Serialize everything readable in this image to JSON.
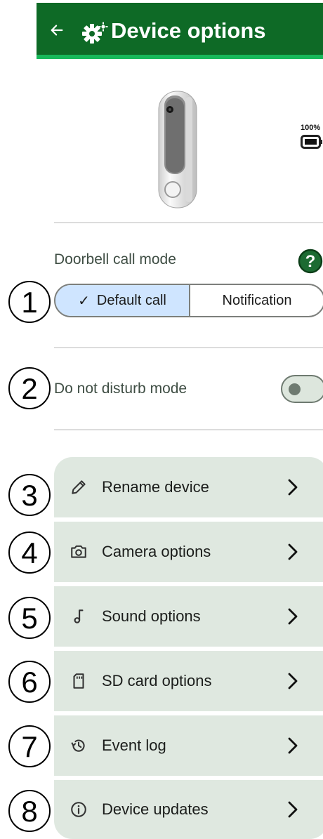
{
  "header": {
    "title": "Device options"
  },
  "device": {
    "battery_text": "100%"
  },
  "call_mode": {
    "title": "Doorbell call mode",
    "options": [
      "Default call",
      "Notification"
    ],
    "selected": "Default call"
  },
  "dnd": {
    "title": "Do not disturb mode",
    "enabled": false
  },
  "menu": {
    "items": [
      {
        "label": "Rename device",
        "icon": "pencil-icon"
      },
      {
        "label": "Camera options",
        "icon": "camera-icon"
      },
      {
        "label": "Sound options",
        "icon": "music-note-icon"
      },
      {
        "label": "SD card options",
        "icon": "sd-card-icon"
      },
      {
        "label": "Event log",
        "icon": "history-icon"
      },
      {
        "label": "Device updates",
        "icon": "info-icon"
      }
    ]
  },
  "annotations": [
    "1",
    "2",
    "3",
    "4",
    "5",
    "6",
    "7",
    "8"
  ],
  "colors": {
    "header_bg": "#0e6a26",
    "header_accent": "#17b85a",
    "selected_bg": "#cfe5ff",
    "menu_bg": "#dfe8e0",
    "help_bg": "#1c6b32"
  }
}
